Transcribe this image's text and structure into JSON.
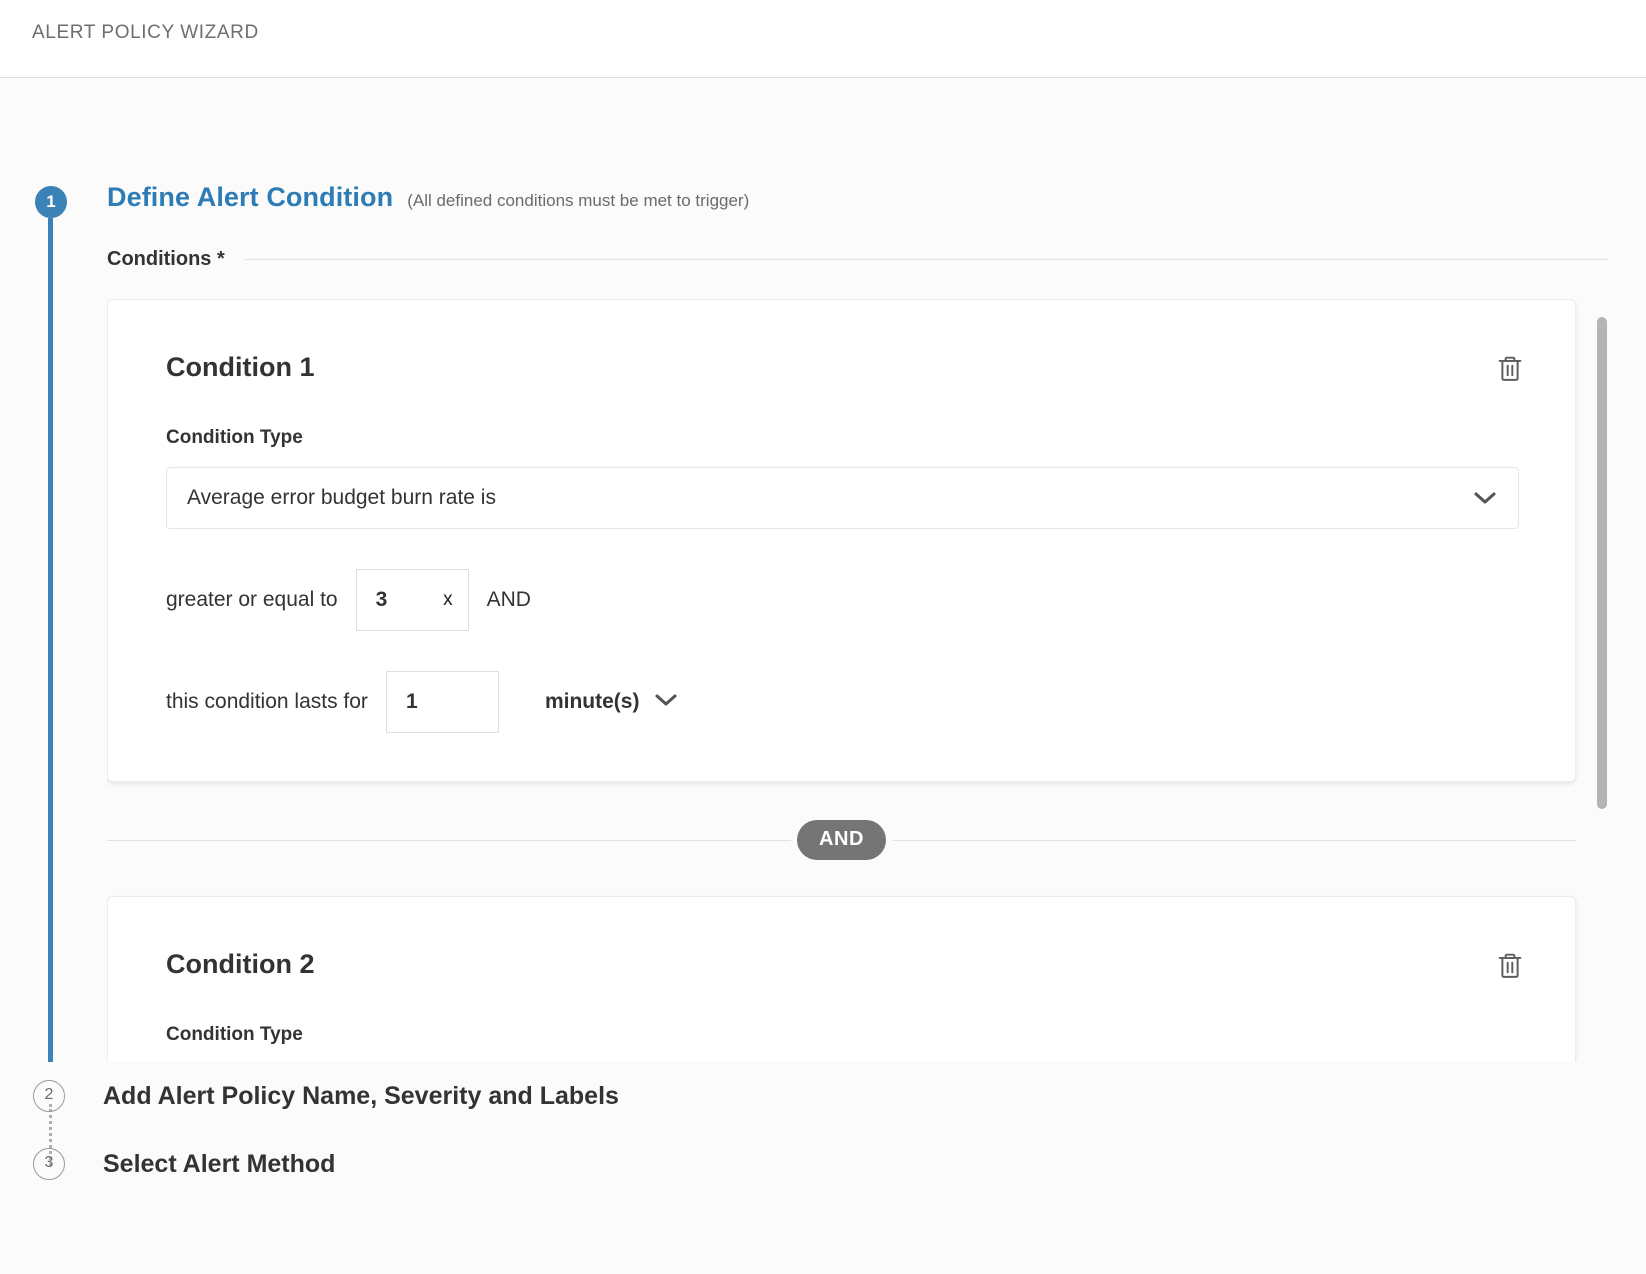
{
  "header": {
    "title": "ALERT POLICY WIZARD"
  },
  "colors": {
    "accent_blue": "#3b82b6",
    "title_blue": "#2e7cb5",
    "and_badge_gray": "#757575",
    "text_dark": "#333333",
    "muted_gray": "#6b6b6b",
    "page_bg": "#fbfbfb"
  },
  "steps": [
    {
      "number": "1",
      "title": "Define Alert Condition",
      "note": "(All defined conditions must be met to trigger)",
      "state": "active"
    },
    {
      "number": "2",
      "title": "Add Alert Policy Name, Severity and Labels",
      "state": "inactive"
    },
    {
      "number": "3",
      "title": "Select Alert Method",
      "state": "inactive"
    }
  ],
  "conditions_section": {
    "legend": "Conditions *",
    "operator_badge": "AND",
    "delete_icon": "trash-icon"
  },
  "conditions": [
    {
      "title": "Condition 1",
      "type_label": "Condition Type",
      "type_value": "Average error budget burn rate is",
      "type_chevron": "chevron-down-icon",
      "comparator_label": "greater or equal to",
      "threshold_value": "3",
      "threshold_suffix": "x",
      "conjunction": "AND",
      "duration_label": "this condition lasts for",
      "duration_value": "1",
      "duration_unit": "minute(s)",
      "duration_chevron": "chevron-down-icon"
    },
    {
      "title": "Condition 2",
      "type_label": "Condition Type"
    }
  ],
  "scrollbar": {
    "name": "conditions-scrollbar"
  }
}
